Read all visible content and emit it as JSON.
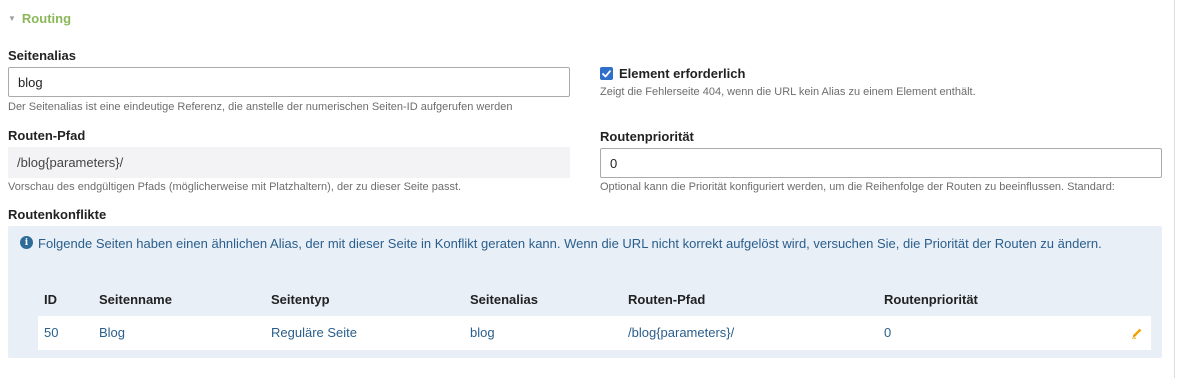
{
  "section": {
    "title": "Routing"
  },
  "alias": {
    "label": "Seitenalias",
    "value": "blog",
    "help": "Der Seitenalias ist eine eindeutige Referenz, die anstelle der numerischen Seiten-ID aufgerufen werden"
  },
  "required_element": {
    "label": "Element erforderlich",
    "checked": true,
    "help": "Zeigt die Fehlerseite 404, wenn die URL kein Alias zu einem Element enthält."
  },
  "route_path": {
    "label": "Routen-Pfad",
    "value": "/blog{parameters}/",
    "help": "Vorschau des endgültigen Pfads (möglicherweise mit Platzhaltern), der zu dieser Seite passt."
  },
  "route_priority": {
    "label": "Routenpriorität",
    "value": "0",
    "help": "Optional kann die Priorität konfiguriert werden, um die Reihenfolge der Routen zu beeinflussen. Standard:"
  },
  "conflicts": {
    "label": "Routenkonflikte",
    "info": "Folgende Seiten haben einen ähnlichen Alias, der mit dieser Seite in Konflikt geraten kann. Wenn die URL nicht korrekt aufgelöst wird, versuchen Sie, die Priorität der Routen zu ändern.",
    "columns": [
      "ID",
      "Seitenname",
      "Seitentyp",
      "Seitenalias",
      "Routen-Pfad",
      "Routenpriorität"
    ],
    "rows": [
      [
        "50",
        "Blog",
        "Reguläre Seite",
        "blog",
        "/blog{parameters}/",
        "0"
      ]
    ]
  },
  "colors": {
    "accent_green": "#8ab858",
    "link_blue": "#2a5e8c",
    "info_bg": "#e8eff7",
    "checkbox_blue": "#2f6fc9",
    "edit_icon": "#f0a500"
  },
  "icons": {
    "legend": "caret-down-icon",
    "info": "info-icon",
    "edit": "pencil-icon",
    "checkbox": "checkmark-icon"
  }
}
